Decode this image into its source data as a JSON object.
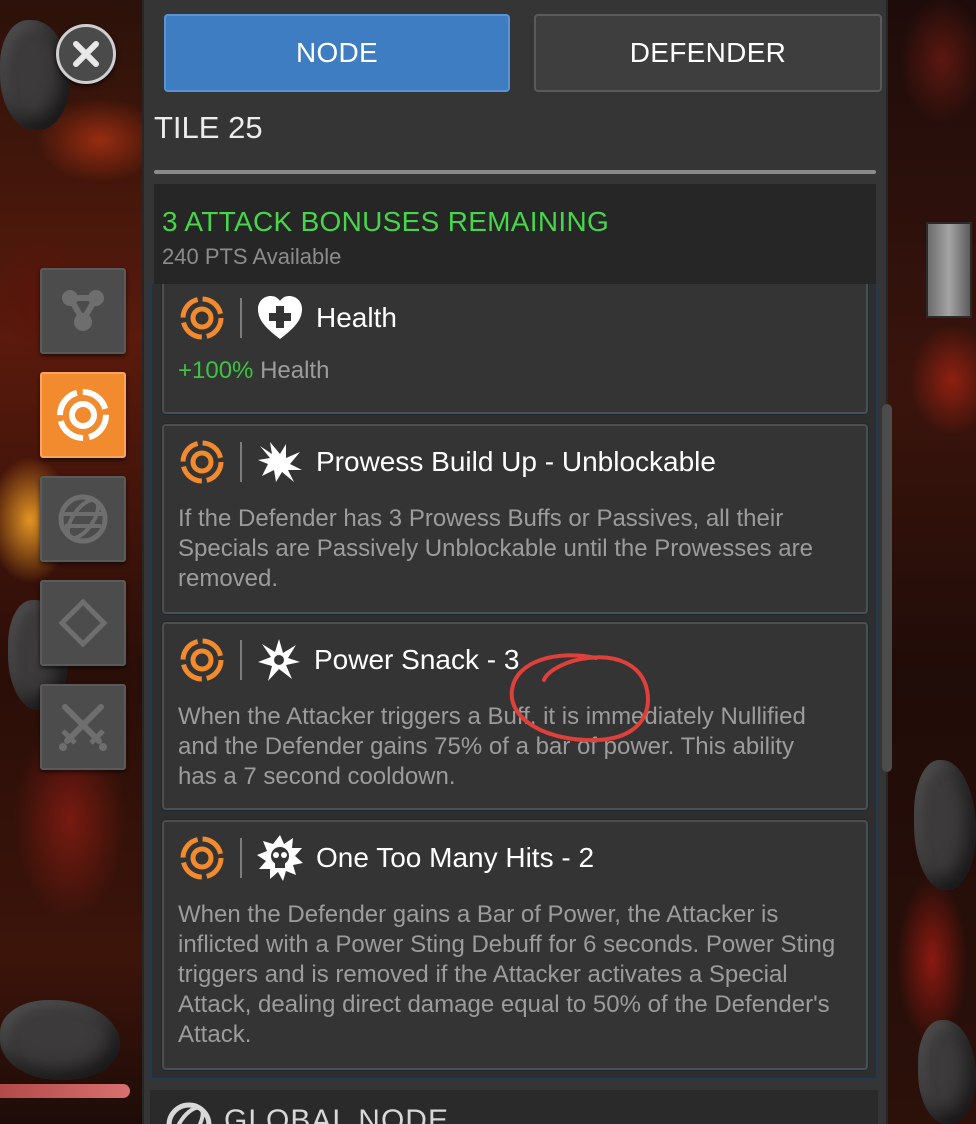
{
  "header": {
    "tabs": [
      {
        "label": "NODE",
        "active": true
      },
      {
        "label": "DEFENDER",
        "active": false
      }
    ],
    "tile_title": "TILE 25"
  },
  "bonuses": {
    "title": "3 ATTACK BONUSES REMAINING",
    "subtitle": "240 PTS Available"
  },
  "side_menu": [
    {
      "icon": "node-link-icon",
      "active": false
    },
    {
      "icon": "target-icon",
      "active": true
    },
    {
      "icon": "globe-icon",
      "active": false
    },
    {
      "icon": "diamond-icon",
      "active": false
    },
    {
      "icon": "crossed-swords-icon",
      "active": false
    }
  ],
  "nodes": [
    {
      "icon": "heart-plus-icon",
      "name": "Health",
      "desc_highlight": "+100%",
      "desc": " Health"
    },
    {
      "icon": "burst-icon",
      "name": "Prowess Build Up - Unblockable",
      "desc": "If the Defender has 3 Prowess Buffs or Passives, all their Specials are Passively Unblockable until the Prowesses are removed."
    },
    {
      "icon": "power-snack-icon",
      "name": "Power Snack - 3",
      "desc": "When the Attacker triggers a Buff, it is immediately Nullified and the Defender gains 75% of a bar of power. This ability has a 7 second cooldown."
    },
    {
      "icon": "skull-burst-icon",
      "name": "One Too Many Hits - 2",
      "desc": "When the Defender gains a Bar of Power, the Attacker is inflicted with a Power Sting Debuff for 6 seconds. Power Sting triggers and is removed if the Attacker activates a Special Attack, dealing direct damage equal to 50% of the Defender's Attack."
    }
  ],
  "global_node": {
    "label": "GLOBAL NODE"
  },
  "colors": {
    "accent_orange": "#f28a2e",
    "node_blue": "#3f7dc2",
    "bonus_green": "#45d64a",
    "annotation_red": "#e0403a"
  }
}
